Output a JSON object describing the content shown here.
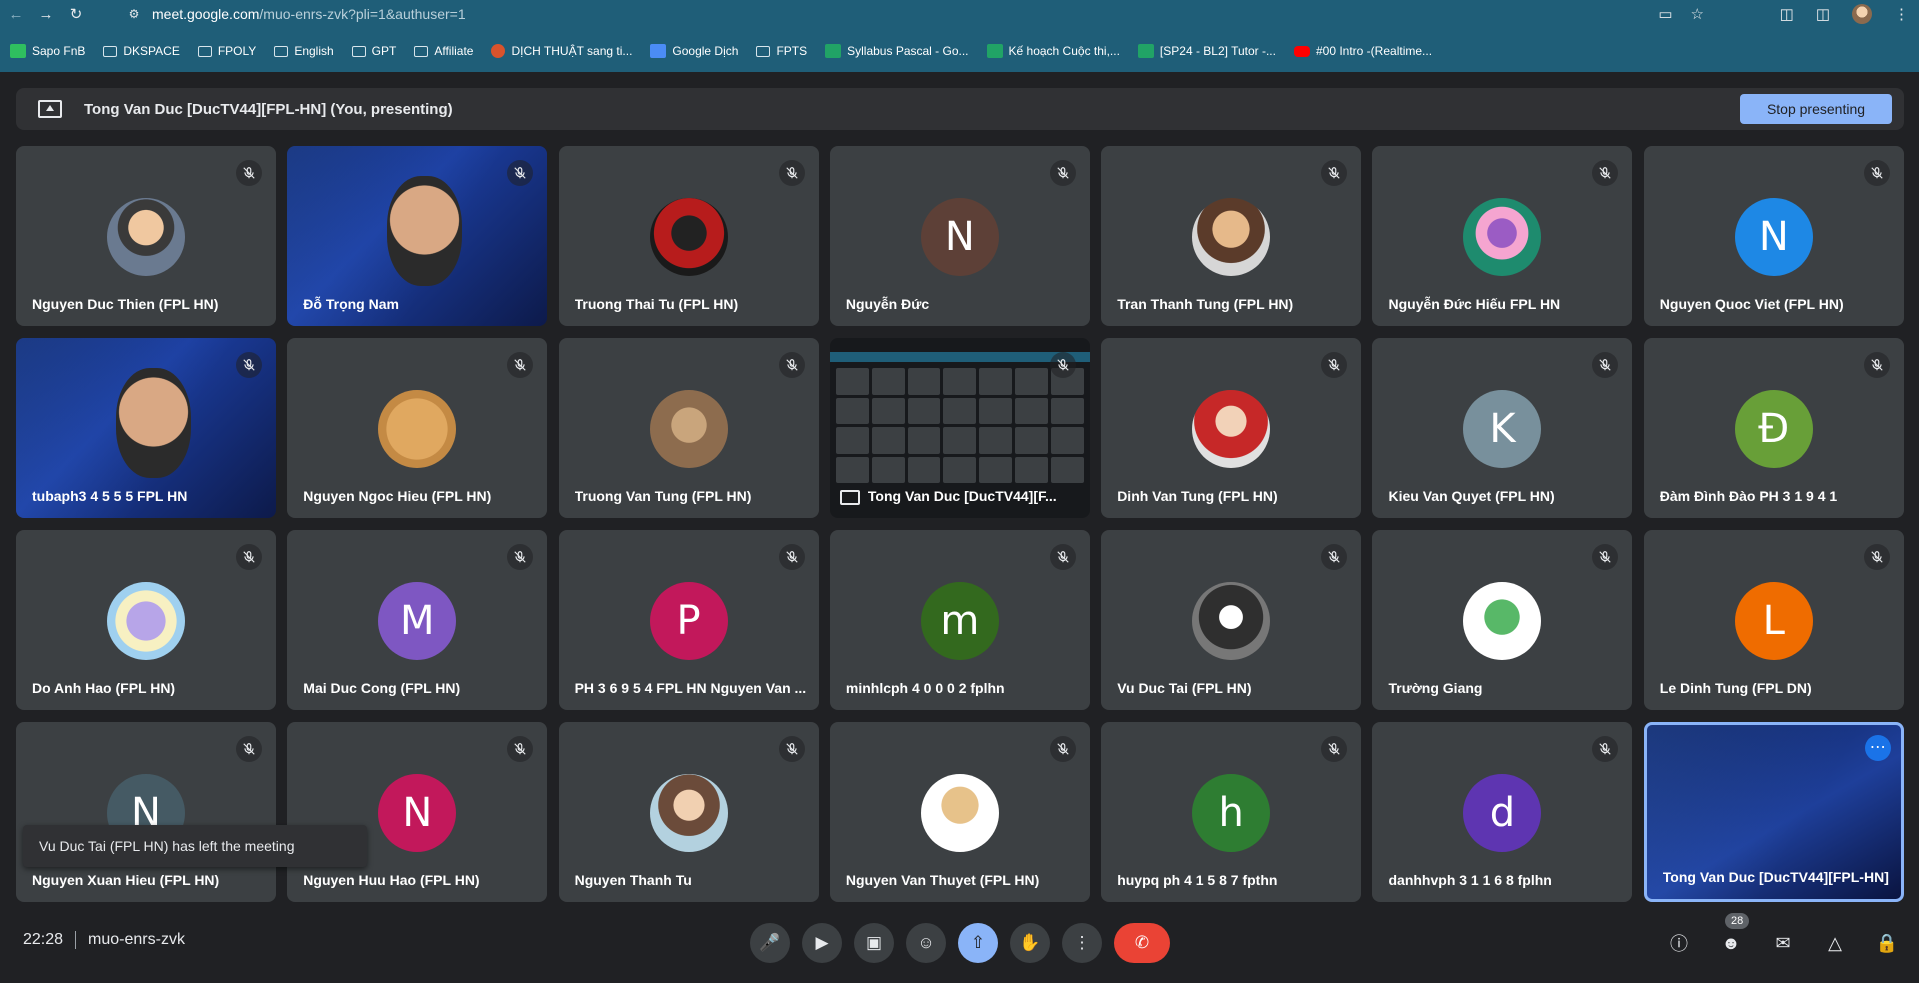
{
  "browser": {
    "url_host": "meet.google.com",
    "url_path": "/muo-enrs-zvk?pli=1&authuser=1",
    "bookmarks": [
      {
        "label": "Sapo FnB",
        "icon": "green"
      },
      {
        "label": "DKSPACE",
        "icon": "folder"
      },
      {
        "label": "FPOLY",
        "icon": "folder"
      },
      {
        "label": "English",
        "icon": "folder"
      },
      {
        "label": "GPT",
        "icon": "folder"
      },
      {
        "label": "Affiliate",
        "icon": "folder"
      },
      {
        "label": "DỊCH THUẬT sang ti...",
        "icon": "red"
      },
      {
        "label": "Google Dịch",
        "icon": "blue"
      },
      {
        "label": "FPTS",
        "icon": "folder"
      },
      {
        "label": "Syllabus Pascal - Go...",
        "icon": "sheet"
      },
      {
        "label": "Kế hoạch Cuộc thi,...",
        "icon": "sheet"
      },
      {
        "label": "[SP24 - BL2] Tutor -...",
        "icon": "sheet"
      },
      {
        "label": "#00 Intro -(Realtime...",
        "icon": "yt"
      }
    ]
  },
  "presenting_bar": {
    "text": "Tong Van Duc [DucTV44][FPL-HN] (You, presenting)",
    "stop_label": "Stop presenting"
  },
  "tiles": [
    {
      "name": "Nguyen Duc Thien (FPL HN)",
      "kind": "photo",
      "style": "p1"
    },
    {
      "name": "Đỗ Trọng Nam",
      "kind": "video"
    },
    {
      "name": "Truong Thai Tu (FPL HN)",
      "kind": "photo",
      "style": "p2"
    },
    {
      "name": "Nguyễn Đức",
      "kind": "letter",
      "letter": "N",
      "color": "#5d4037"
    },
    {
      "name": "Tran Thanh Tung (FPL HN)",
      "kind": "photo",
      "style": "p3"
    },
    {
      "name": "Nguyễn Đức Hiếu FPL HN",
      "kind": "photo",
      "style": "p4"
    },
    {
      "name": "Nguyen Quoc Viet (FPL HN)",
      "kind": "letter",
      "letter": "N",
      "color": "#1e88e5"
    },
    {
      "name": "tubaph3 4 5 5 5 FPL HN",
      "kind": "video"
    },
    {
      "name": "Nguyen Ngoc Hieu (FPL HN)",
      "kind": "photo",
      "style": "p5"
    },
    {
      "name": "Truong Van Tung (FPL HN)",
      "kind": "photo",
      "style": "p6"
    },
    {
      "name": "Tong Van Duc [DucTV44][F...",
      "kind": "screen"
    },
    {
      "name": "Dinh Van Tung (FPL HN)",
      "kind": "photo",
      "style": "p7"
    },
    {
      "name": "Kieu Van Quyet (FPL HN)",
      "kind": "letter",
      "letter": "K",
      "color": "#78909c"
    },
    {
      "name": "Đàm Đình Đào PH 3 1 9 4 1",
      "kind": "letter",
      "letter": "Đ",
      "color": "#689f38"
    },
    {
      "name": "Do Anh Hao (FPL HN)",
      "kind": "photo",
      "style": "p8"
    },
    {
      "name": "Mai Duc Cong (FPL HN)",
      "kind": "letter",
      "letter": "M",
      "color": "#7e57c2"
    },
    {
      "name": "PH 3 6 9 5 4 FPL HN Nguyen Van ...",
      "kind": "letter",
      "letter": "P",
      "color": "#c2185b"
    },
    {
      "name": "minhlcph 4 0 0 0 2 fplhn",
      "kind": "letter",
      "letter": "m",
      "color": "#33691e"
    },
    {
      "name": "Vu Duc Tai (FPL HN)",
      "kind": "photo",
      "style": "p9"
    },
    {
      "name": "Trường Giang",
      "kind": "photo",
      "style": "p10"
    },
    {
      "name": "Le Dinh Tung (FPL DN)",
      "kind": "letter",
      "letter": "L",
      "color": "#ef6c00"
    },
    {
      "name": "Nguyen Xuan Hieu (FPL HN)",
      "kind": "letter",
      "letter": "N",
      "color": "#455a64"
    },
    {
      "name": "Nguyen Huu Hao (FPL HN)",
      "kind": "letter",
      "letter": "N",
      "color": "#c2185b"
    },
    {
      "name": "Nguyen Thanh Tu",
      "kind": "photo",
      "style": "p11"
    },
    {
      "name": "Nguyen Van Thuyet (FPL HN)",
      "kind": "photo",
      "style": "p12"
    },
    {
      "name": "huypq ph 4 1 5 8 7 fpthn",
      "kind": "letter",
      "letter": "h",
      "color": "#2e7d32"
    },
    {
      "name": "danhhvph 3 1 1 6 8 fplhn",
      "kind": "letter",
      "letter": "d",
      "color": "#5e35b1"
    },
    {
      "name": "Tong Van Duc [DucTV44][FPL-HN]",
      "kind": "self"
    }
  ],
  "toast": "Vu Duc Tai (FPL HN) has left the meeting",
  "bottom": {
    "time": "22:28",
    "meeting_code": "muo-enrs-zvk",
    "participant_count": "28",
    "accent": "#8ab4f8",
    "end_color": "#ea4335"
  }
}
